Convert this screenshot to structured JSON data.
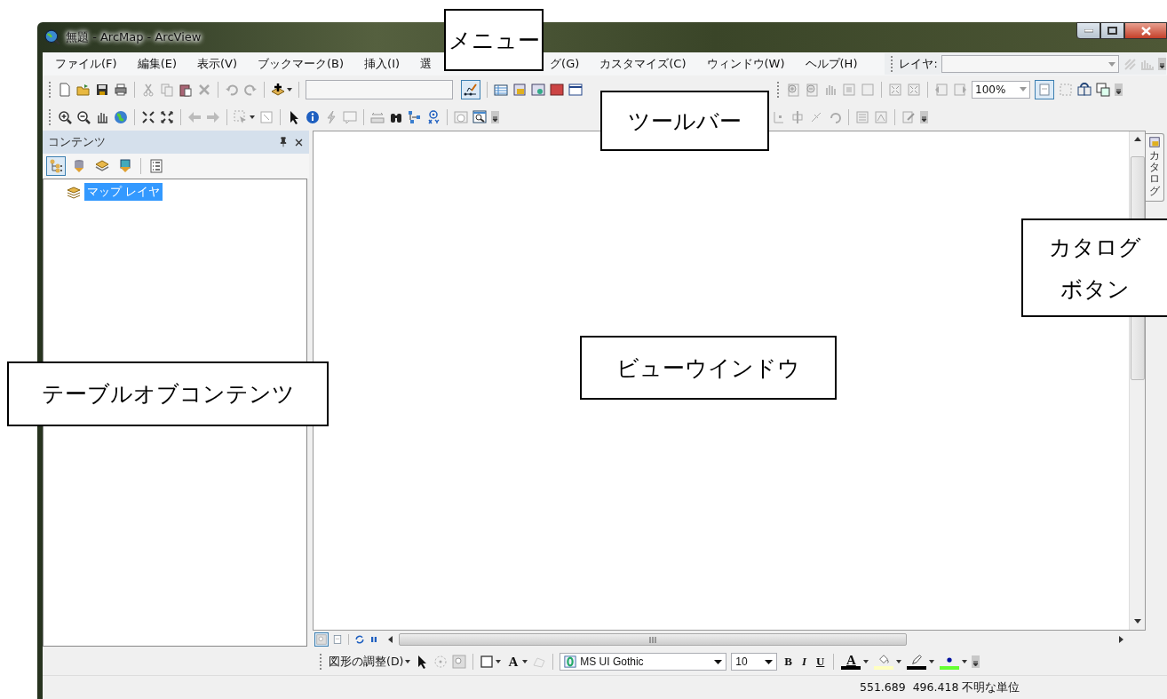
{
  "window": {
    "title": "無題 - ArcMap - ArcView"
  },
  "menu": [
    {
      "label": "ファイル(F)"
    },
    {
      "label": "編集(E)"
    },
    {
      "label": "表示(V)"
    },
    {
      "label": "ブックマーク(B)"
    },
    {
      "label": "挿入(I)"
    },
    {
      "label": "選"
    },
    {
      "label": "グ(G)"
    },
    {
      "label": "カスタマイズ(C)"
    },
    {
      "label": "ウィンドウ(W)"
    },
    {
      "label": "ヘルプ(H)"
    }
  ],
  "layer_toolbar": {
    "label": "レイヤ:"
  },
  "layout_toolbar": {
    "zoom": "100%"
  },
  "toc": {
    "title": "コンテンツ",
    "tabs": [
      {
        "kind": "drawing-order",
        "selected": true
      },
      {
        "kind": "source",
        "selected": false
      },
      {
        "kind": "visibility",
        "selected": false
      },
      {
        "kind": "selection",
        "selected": false
      },
      {
        "kind": "options",
        "selected": false
      }
    ],
    "items": [
      {
        "label": "マップ レイヤ",
        "selected": true
      }
    ]
  },
  "catalog_tab": {
    "label": "カタログ"
  },
  "drawing_toolbar": {
    "menu": "図形の調整(D)",
    "text_glyph": "A",
    "font": "MS UI Gothic",
    "size": "10",
    "bold": "B",
    "italic": "I",
    "underline": "U",
    "color_buttons": [
      {
        "kind": "font",
        "glyph": "A",
        "color": "#000000"
      },
      {
        "kind": "fill",
        "color": "#ffffc0"
      },
      {
        "kind": "line",
        "color": "#000000"
      },
      {
        "kind": "marker",
        "color": "#66ff33"
      }
    ]
  },
  "status_bar": {
    "coordinates": "551.689  496.418 不明な単位"
  },
  "callouts": [
    {
      "kind": "menu",
      "lines": [
        "メニュー"
      ]
    },
    {
      "kind": "toolbar",
      "lines": [
        "ツールバー"
      ]
    },
    {
      "kind": "catalog",
      "lines": [
        "カタログ",
        "ボタン"
      ]
    },
    {
      "kind": "view",
      "lines": [
        "ビューウインドウ"
      ]
    },
    {
      "kind": "toc",
      "lines": [
        "テーブルオブコンテンツ"
      ]
    }
  ]
}
